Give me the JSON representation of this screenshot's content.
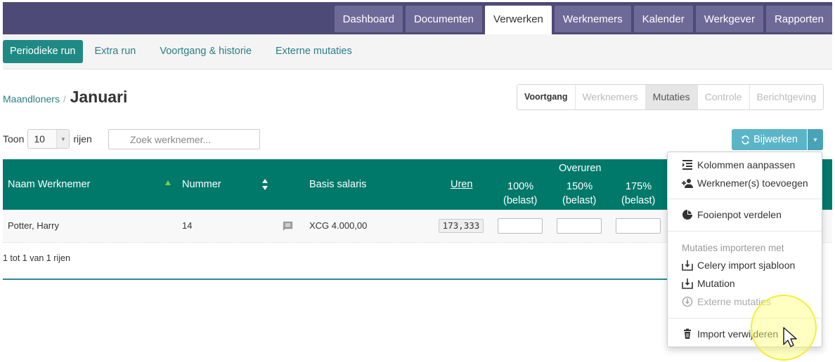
{
  "top_nav": {
    "tabs": [
      {
        "label": "Dashboard",
        "active": false
      },
      {
        "label": "Documenten",
        "active": false
      },
      {
        "label": "Verwerken",
        "active": true
      },
      {
        "label": "Werknemers",
        "active": false
      },
      {
        "label": "Kalender",
        "active": false
      },
      {
        "label": "Werkgever",
        "active": false
      },
      {
        "label": "Rapporten",
        "active": false
      }
    ]
  },
  "sub_nav": {
    "items": [
      {
        "label": "Periodieke run",
        "active": true
      },
      {
        "label": "Extra run",
        "active": false
      },
      {
        "label": "Voortgang & historie",
        "active": false
      },
      {
        "label": "Externe mutaties",
        "active": false
      }
    ]
  },
  "breadcrumb": {
    "parent": "Maandloners",
    "separator": "/",
    "current": "Januari"
  },
  "steps": [
    {
      "label": "Voortgang",
      "state": "done"
    },
    {
      "label": "Werknemers",
      "state": "pending"
    },
    {
      "label": "Mutaties",
      "state": "current"
    },
    {
      "label": "Controle",
      "state": "pending"
    },
    {
      "label": "Berichtgeving",
      "state": "pending"
    }
  ],
  "toolbar": {
    "show_label": "Toon",
    "page_size": "10",
    "rows_label": "rijen",
    "search_placeholder": "Zoek werknemer...",
    "update_button": "Bijwerken"
  },
  "table": {
    "headers": {
      "name": "Naam Werknemer",
      "number": "Nummer",
      "salary": "Basis salaris",
      "hours": "Uren",
      "overtime_group": "Overuren",
      "ot100": "100%",
      "ot150": "150%",
      "ot175": "175%",
      "taxed": "(belast)"
    },
    "rows": [
      {
        "name": "Potter, Harry",
        "number": "14",
        "salary": "XCG 4.000,00",
        "hours": "173,333"
      }
    ],
    "footer": "1 tot 1 van 1 rijen"
  },
  "dropdown_menu": {
    "items": [
      {
        "label": "Kolommen aanpassen",
        "icon": "columns-icon"
      },
      {
        "label": "Werknemer(s) toevoegen",
        "icon": "add-user-icon"
      },
      {
        "label": "Fooienpot verdelen",
        "icon": "pie-chart-icon"
      }
    ],
    "import_header": "Mutaties importeren met",
    "import_items": [
      {
        "label": "Celery import sjabloon",
        "icon": "import-icon",
        "disabled": false
      },
      {
        "label": "Mutation",
        "icon": "import-icon",
        "disabled": false
      },
      {
        "label": "Externe mutaties",
        "icon": "download-circle-icon",
        "disabled": true
      }
    ],
    "delete_item": {
      "label": "Import verwijderen",
      "icon": "trash-icon"
    }
  },
  "colors": {
    "header_bar": "#4e4a77",
    "tab": "#6e6a98",
    "teal": "#00796b",
    "primary_button": "#5bb5c9"
  }
}
